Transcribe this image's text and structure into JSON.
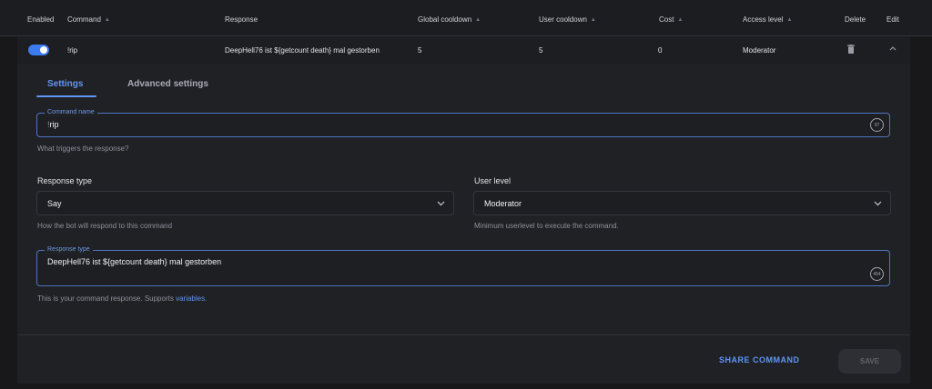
{
  "table": {
    "headers": {
      "enabled": "Enabled",
      "command": "Command",
      "response": "Response",
      "global_cooldown": "Global cooldown",
      "user_cooldown": "User cooldown",
      "cost": "Cost",
      "access_level": "Access level",
      "delete": "Delete",
      "edit": "Edit"
    },
    "row": {
      "enabled": true,
      "command": "!rip",
      "response": "DeepHell76 ist ${getcount death} mal gestorben",
      "global_cooldown": "5",
      "user_cooldown": "5",
      "cost": "0",
      "access_level": "Moderator"
    }
  },
  "tabs": [
    {
      "label": "Settings",
      "active": true
    },
    {
      "label": "Advanced settings",
      "active": false
    }
  ],
  "command_name": {
    "label": "Command name",
    "prefix": "!",
    "value": "rip",
    "counter": "97",
    "helper": "What triggers the response?"
  },
  "response_type": {
    "section_label": "Response type",
    "value": "Say",
    "helper": "How the bot will respond to this command"
  },
  "user_level": {
    "section_label": "User level",
    "value": "Moderator",
    "helper": "Minimum userlevel to execute the command."
  },
  "response": {
    "label": "Response type",
    "value": "DeepHell76 ist ${getcount death} mal gestorben",
    "counter": "454",
    "helper_text": "This is your command response. Supports ",
    "helper_link": "variables",
    "helper_end": "."
  },
  "actions": {
    "share": "SHARE COMMAND",
    "save": "SAVE"
  },
  "colors": {
    "accent": "#3d7cf0",
    "background": "#1f2024"
  }
}
